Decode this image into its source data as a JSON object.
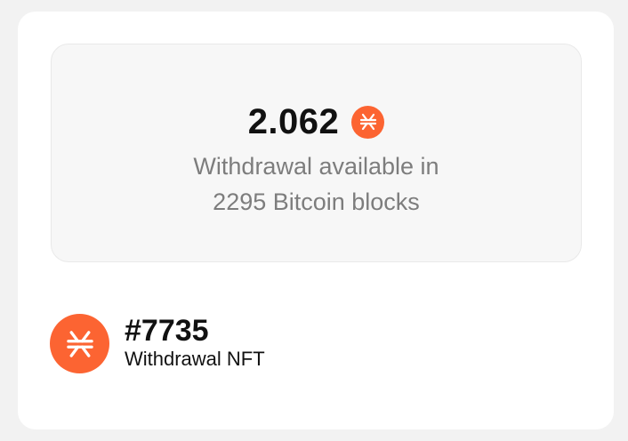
{
  "balance": {
    "amount": "2.062",
    "token_icon": "stx-icon",
    "withdraw_line1": "Withdrawal available in",
    "withdraw_line2": "2295 Bitcoin blocks"
  },
  "nft": {
    "icon": "stx-icon",
    "id": "#7735",
    "label": "Withdrawal NFT"
  },
  "colors": {
    "accent": "#fc6432",
    "muted_text": "#7d7d7d",
    "panel_bg": "#f7f7f7",
    "page_bg": "#f2f2f2"
  }
}
